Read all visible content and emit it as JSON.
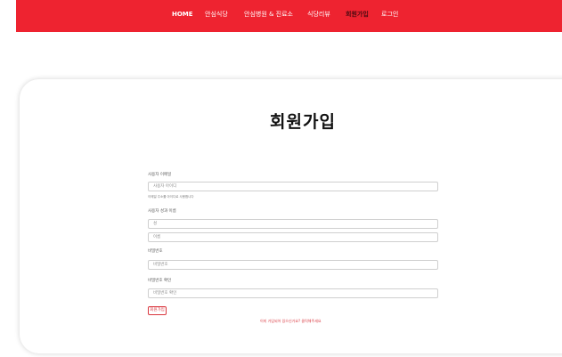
{
  "nav": {
    "items": [
      {
        "label": "HOME"
      },
      {
        "label": "안심식당"
      },
      {
        "label": "안심병원 & 진료소"
      },
      {
        "label": "식당리뷰"
      },
      {
        "label": "회원가입"
      },
      {
        "label": "로그인"
      }
    ],
    "active_index": 4
  },
  "form": {
    "title": "회원가입",
    "id_label": "사용자 이메일",
    "id_placeholder": "사용자 아이디",
    "id_hint": "이메일 주소를 아이디로 사용합니다",
    "name_label": "사용자 성과 이름",
    "last_name_placeholder": "성",
    "first_name_placeholder": "이름",
    "password_label": "비밀번호",
    "password_placeholder": "비밀번호",
    "confirm_label": "비밀번호 확인",
    "confirm_placeholder": "비밀번호 확인",
    "submit_label": "회원가입",
    "login_link": "이미 가입되어 있으신가요? 클릭해주세요"
  },
  "colors": {
    "brand": "#ee2330",
    "nav_active": "#4a0a10",
    "button": "#d9363e"
  }
}
